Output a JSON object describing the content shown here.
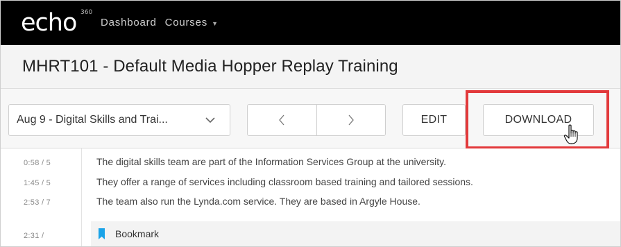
{
  "app": {
    "logo_text": "echo",
    "logo_superscript": "360"
  },
  "nav": {
    "dashboard_label": "Dashboard",
    "courses_label": "Courses"
  },
  "course": {
    "title": "MHRT101 - Default Media Hopper Replay Training"
  },
  "toolbar": {
    "session_select_value": "Aug 9 - Digital Skills and Trai...",
    "prev_icon": "chevron-left-icon",
    "next_icon": "chevron-right-icon",
    "edit_label": "EDIT",
    "download_label": "DOWNLOAD"
  },
  "colors": {
    "topbar_bg": "#000000",
    "highlight_border": "#e2393b",
    "bookmark_accent": "#1aa3e8"
  },
  "transcript": {
    "lines": [
      {
        "time": "0:58  /  5",
        "text": "The digital skills team are part of the Information Services Group at the university."
      },
      {
        "time": "1:45  /  5",
        "text": "They offer a range of services including classroom based training and tailored sessions."
      },
      {
        "time": "2:53  /  7",
        "text": "The team also run the Lynda.com service. They are based in Argyle House."
      }
    ],
    "bookmark": {
      "time": "2:31  /",
      "label": "Bookmark"
    }
  }
}
